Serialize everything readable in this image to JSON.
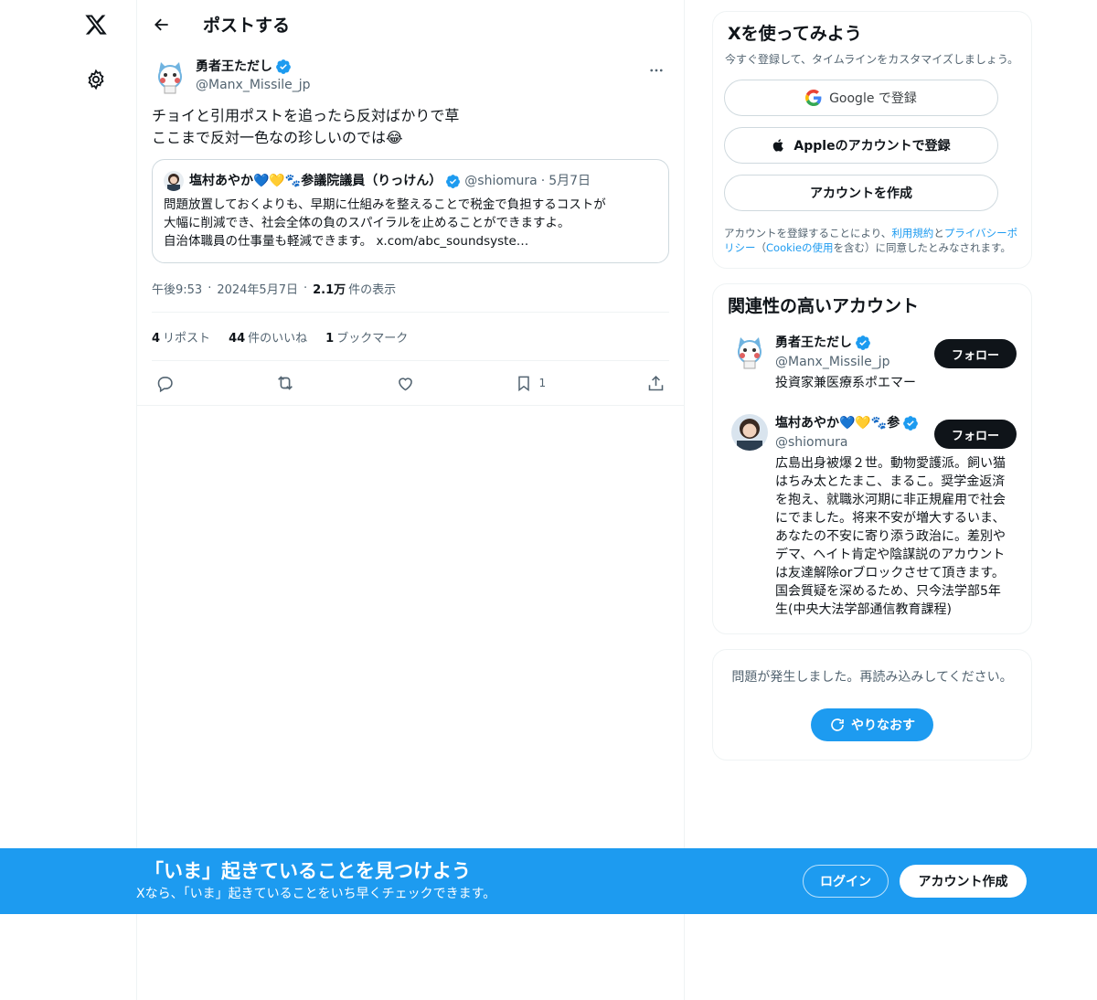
{
  "header": {
    "title": "ポストする"
  },
  "post": {
    "author": {
      "name": "勇者王ただし",
      "handle": "@Manx_Missile_jp"
    },
    "text_lines": [
      "チョイと引用ポストを追ったら反対ばかりで草",
      "ここまで反対一色なの珍しいのでは😂"
    ],
    "quote": {
      "name": "塩村あやか💙💛🐾参議院議員（りっけん）",
      "handle": "@shiomura",
      "dot": "·",
      "date": "5月7日",
      "lines": [
        "問題放置しておくよりも、早期に仕組みを整えることで税金で負担するコストが",
        "大幅に削減でき、社会全体の負のスパイラルを止めることができますよ。",
        "自治体職員の仕事量も軽減できます。 x.com/abc_soundsyste…"
      ]
    },
    "meta": {
      "time": "午後9:53",
      "sep": "·",
      "date": "2024年5月7日",
      "views_count": "2.1万",
      "views_label": "件の表示"
    },
    "stats": [
      {
        "count": "4",
        "label": "リポスト"
      },
      {
        "count": "44",
        "label": "件のいいね"
      },
      {
        "count": "1",
        "label": "ブックマーク"
      }
    ],
    "bookmark_count": "1"
  },
  "signup": {
    "title": "Xを使ってみよう",
    "subtitle": "今すぐ登録して、タイムラインをカスタマイズしましょう。",
    "google_label": "Google で登録",
    "apple_label": "Appleのアカウントで登録",
    "create_label": "アカウントを作成",
    "terms_1": "アカウントを登録することにより、",
    "terms_link_1": "利用規約",
    "terms_2": "と",
    "terms_link_2": "プライバシーポリシー",
    "terms_3": "（",
    "terms_link_3": "Cookieの使用",
    "terms_4": "を含む）に同意したとみなされます。"
  },
  "related": {
    "title": "関連性の高いアカウント",
    "accounts": [
      {
        "name": "勇者王ただし",
        "handle": "@Manx_Missile_jp",
        "bio": "投資家兼医療系ポエマー",
        "follow": "フォロー"
      },
      {
        "name": "塩村あやか💙💛🐾参",
        "handle": "@shiomura",
        "bio": "広島出身被爆２世。動物愛護派。飼い猫はちみ太とたまこ、まるこ。奨学金返済を抱え、就職氷河期に非正規雇用で社会にでました。将来不安が増大するいま、あなたの不安に寄り添う政治に。差別やデマ、ヘイト肯定や陰謀説のアカウントは友達解除orブロックさせて頂きます。国会質疑を深めるため、只今法学部5年生(中央大法学部通信教育課程)",
        "follow": "フォロー"
      }
    ]
  },
  "error": {
    "text": "問題が発生しました。再読み込みしてください。",
    "retry": "やりなおす"
  },
  "banner": {
    "title": "「いま」起きていることを見つけよう",
    "subtitle": "Xなら、「いま」起きていることをいち早くチェックできます。",
    "login": "ログイン",
    "create": "アカウント作成"
  },
  "colors": {
    "accent": "#1d9bf0",
    "text": "#0f1419",
    "muted": "#536471",
    "border": "#eff3f4"
  }
}
